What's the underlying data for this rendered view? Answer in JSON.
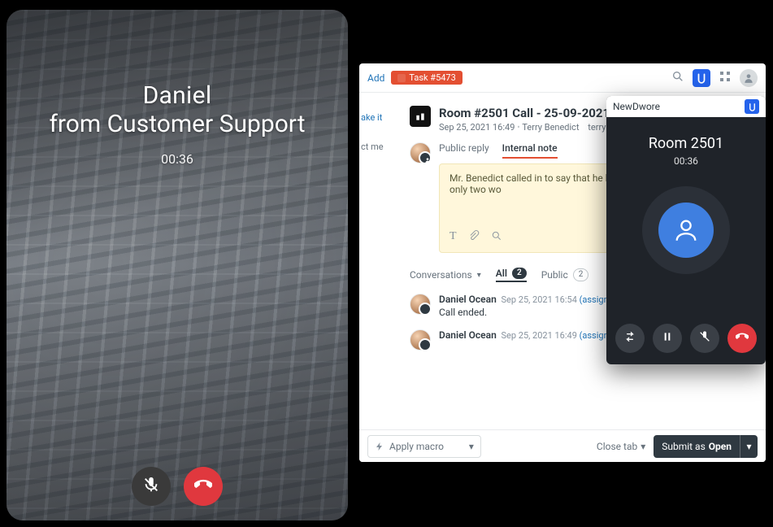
{
  "mobile_call": {
    "name": "Daniel",
    "dept": "from Customer Support",
    "timer": "00:36"
  },
  "desk": {
    "topbar": {
      "add": "Add",
      "task_label": "Task #5473"
    },
    "ticket": {
      "title": "Room #2501 Call - 25-09-2021",
      "timestamp": "Sep 25, 2021 16:49",
      "requester": "Terry Benedict",
      "email": "terry@miragecas"
    },
    "reply": {
      "tabs": {
        "public": "Public reply",
        "internal": "Internal note"
      },
      "note_text": "Mr. Benedict called in to say that he has only two wo"
    },
    "conversations": {
      "label": "Conversations",
      "all_label": "All",
      "all_count": "2",
      "public_label": "Public",
      "public_count": "2"
    },
    "events": [
      {
        "author": "Daniel Ocean",
        "time": "Sep 25, 2021 16:54",
        "assign": "(assign)",
        "text": "Call ended."
      },
      {
        "author": "Daniel Ocean",
        "time": "Sep 25, 2021 16:49",
        "assign": "(assign)",
        "text": ""
      }
    ],
    "footer": {
      "macro": "Apply macro",
      "close_tab": "Close tab",
      "submit_prefix": "Submit as ",
      "submit_status": "Open"
    },
    "side_snippet": {
      "ake_it": "ake it",
      "ct_me": "ct me"
    }
  },
  "dialer": {
    "app": "NewDwore",
    "title": "Room 2501",
    "timer": "00:36"
  }
}
